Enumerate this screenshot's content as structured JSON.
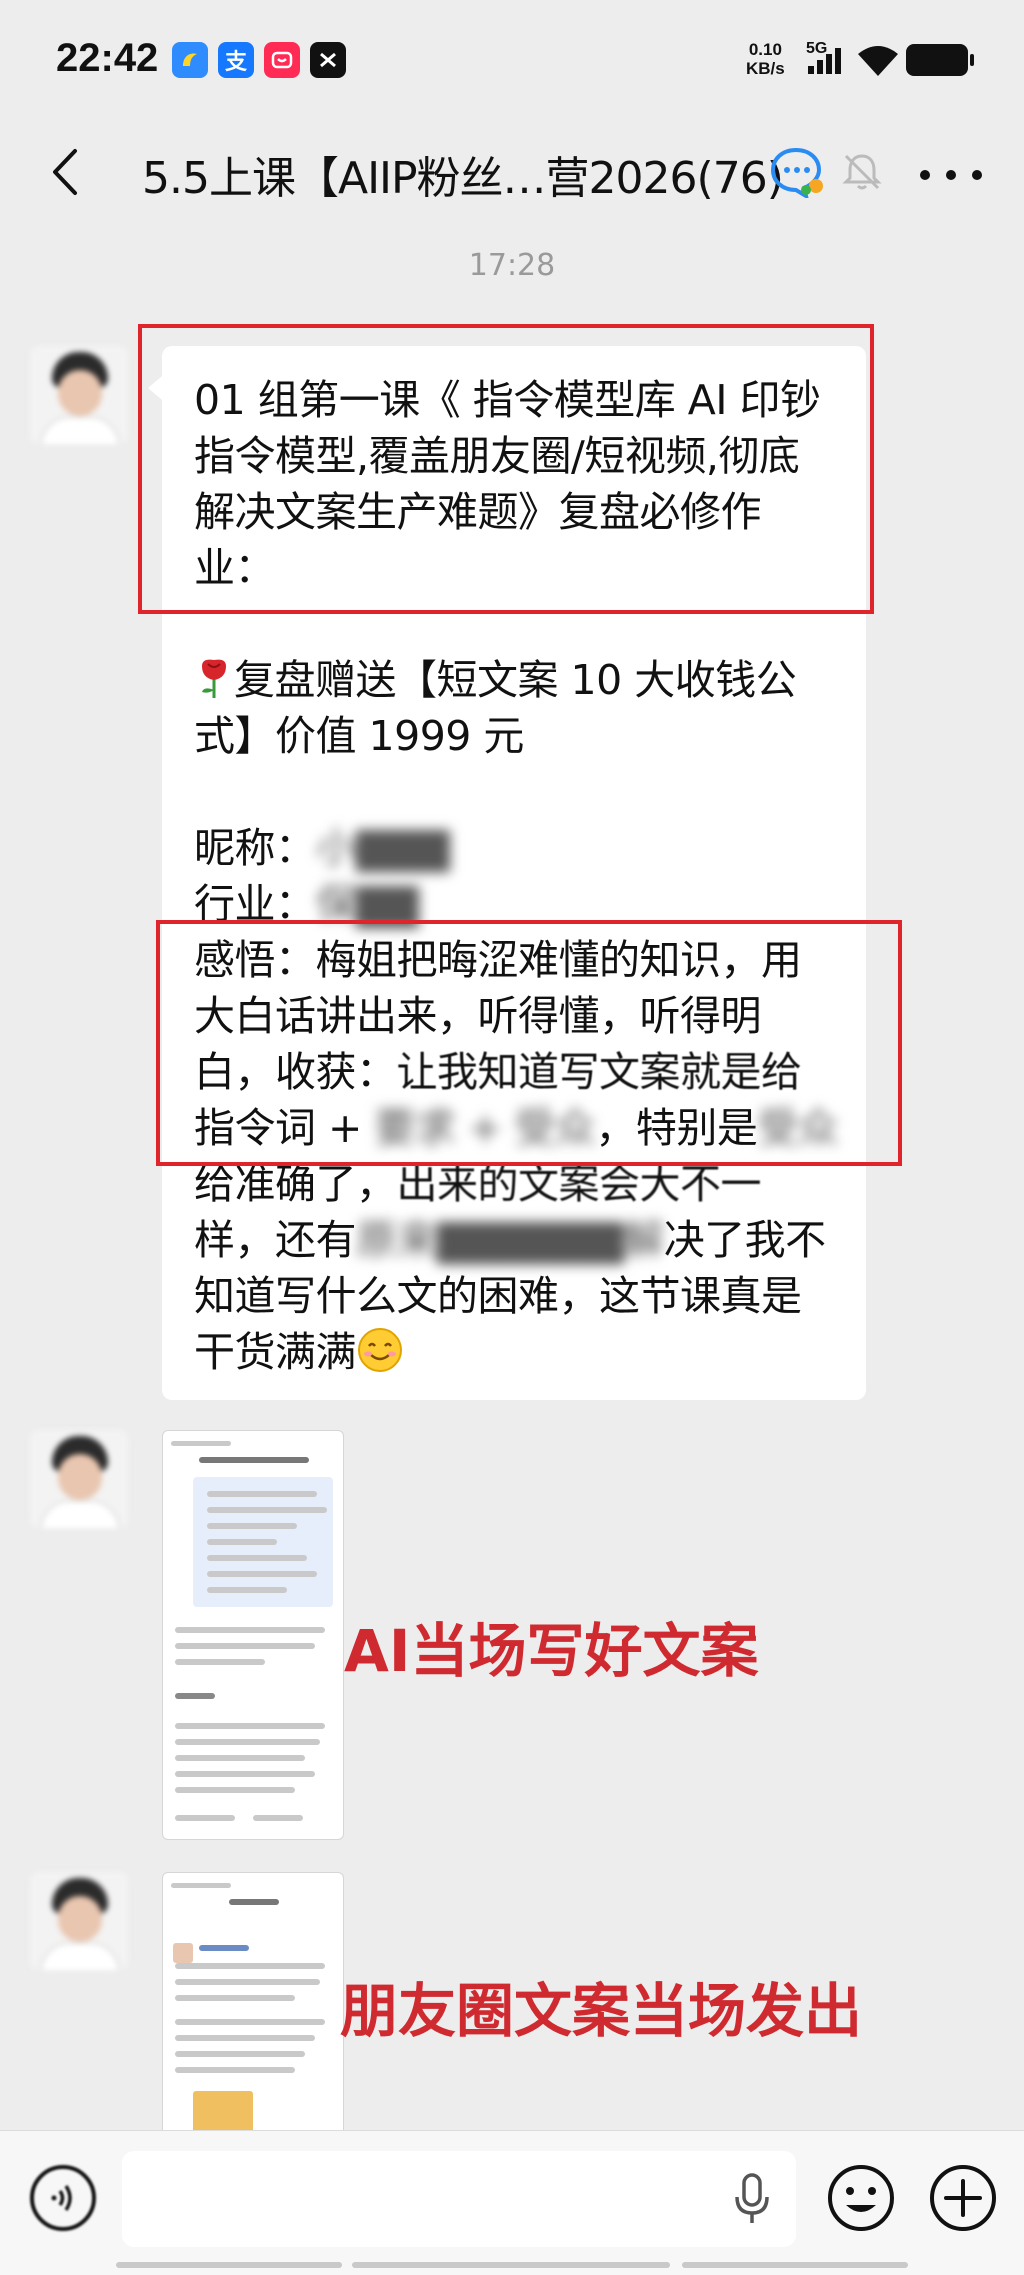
{
  "status_bar": {
    "time": "22:42",
    "net_speed_value": "0.10",
    "net_speed_unit": "KB/s",
    "network": "5G",
    "app_icons": [
      "yuque-icon",
      "alipay-icon",
      "mall-icon",
      "capcut-icon"
    ]
  },
  "nav": {
    "title": "5.5上课【AIIP粉丝…营2026(76)"
  },
  "chat": {
    "timestamp": "17:28",
    "message": {
      "lines_boxed_1": [
        "01 组第一课《 指令模型库 AI 印钞",
        "指令模型,覆盖朋友圈/短视频,彻底",
        "解决文案生产难题》复盘必修作",
        "业："
      ],
      "bonus_line1": "复盘赠送【短文案 10 大收钱公",
      "bonus_line2": "式】价值 1999 元",
      "nickname_label": "昵称：",
      "nickname_value": "小▇▇▇",
      "industry_label": "行业：",
      "industry_value": "保▇▇",
      "insight_line1": "感悟：梅姐把晦涩难懂的知识，用",
      "insight_line2": "大白话讲出来，听得懂，听得明",
      "insight_line3_a": "白，收获：",
      "insight_line3_b": "让我知道写文案就是给",
      "insight_line4_a": "指令词 + ",
      "insight_line4_blur1": "要求 + 受众",
      "insight_line4_b": "，特别是",
      "insight_line4_blur2": "受众",
      "rest_line1_a": "给准确了，",
      "rest_line1_b": "出来的文案会大不一",
      "rest_line2_a": "样，还有",
      "rest_line2_blur": "原来▇▇▇▇▇▇解",
      "rest_line2_b": "决了我不",
      "rest_line3": "知道写什么文的困难，这节课真是",
      "rest_line4": "干货满满"
    },
    "image_msg_1": {
      "caption": "AI当场写好文案"
    },
    "image_msg_2": {
      "caption": "朋友圈文案当场发出"
    }
  },
  "input_bar": {
    "placeholder": ""
  },
  "colors": {
    "highlight": "#e0242b",
    "caption": "#cf2a2f",
    "bg": "#ededed"
  }
}
